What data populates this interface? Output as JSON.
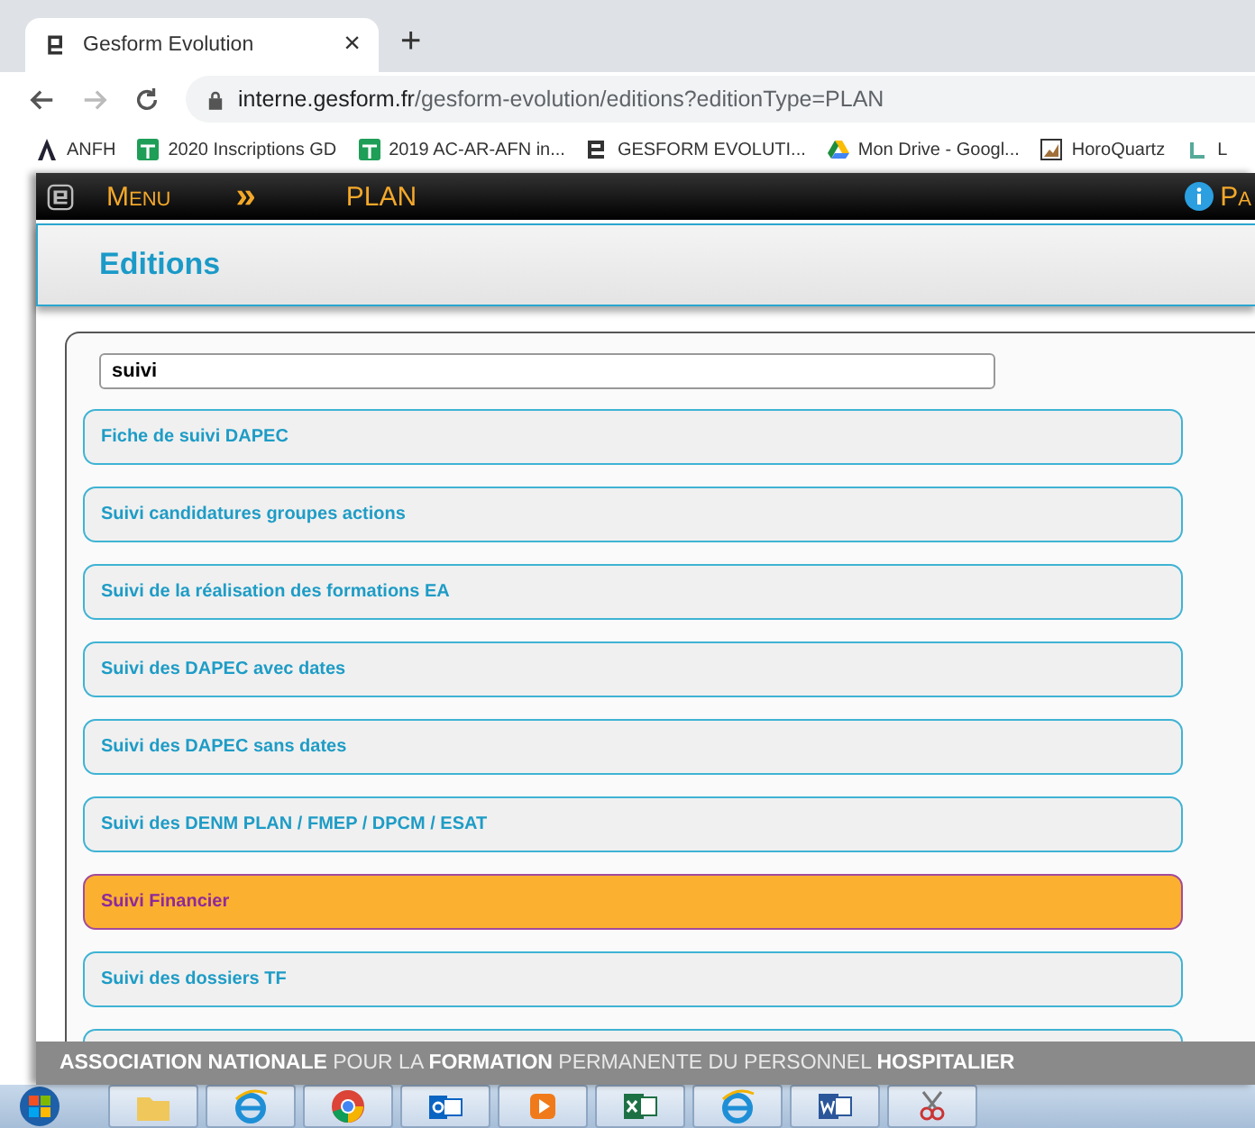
{
  "browser": {
    "tab": {
      "title": "Gesform Evolution",
      "close": "×"
    },
    "new_tab": "+",
    "nav": [
      {
        "kind": "back",
        "disabled": false
      },
      {
        "kind": "forward",
        "disabled": true
      },
      {
        "kind": "reload",
        "disabled": false
      }
    ],
    "url": {
      "host": "interne.gesform.fr",
      "path": "/gesform-evolution/editions?editionType=PLAN"
    },
    "bookmarks": [
      {
        "kind": "anfh",
        "label": "ANFH"
      },
      {
        "kind": "sheet",
        "label": "2020 Inscriptions GD"
      },
      {
        "kind": "sheet",
        "label": "2019 AC-AR-AFN in..."
      },
      {
        "kind": "gesform",
        "label": "GESFORM EVOLUTI..."
      },
      {
        "kind": "drive",
        "label": "Mon Drive - Googl..."
      },
      {
        "kind": "image",
        "label": "HoroQuartz"
      },
      {
        "kind": "swirl",
        "label": "L"
      }
    ]
  },
  "app_bar": {
    "menu": "Menu",
    "arrows": "»",
    "section": "PLAN",
    "right": "Pa"
  },
  "page_title": "Editions",
  "search": {
    "value": "suivi"
  },
  "items": [
    {
      "label": "Fiche de suivi DAPEC",
      "selected": false
    },
    {
      "label": "Suivi candidatures groupes actions",
      "selected": false
    },
    {
      "label": "Suivi de la réalisation des formations EA",
      "selected": false
    },
    {
      "label": "Suivi des DAPEC avec dates",
      "selected": false
    },
    {
      "label": "Suivi des DAPEC sans dates",
      "selected": false
    },
    {
      "label": "Suivi des DENM PLAN / FMEP / DPCM / ESAT",
      "selected": false
    },
    {
      "label": "Suivi Financier",
      "selected": true
    },
    {
      "label": "Suivi des dossiers TF",
      "selected": false
    }
  ],
  "footer": "**ASSOCIATION NATIONALE** POUR LA **FORMATION** PERMANENTE DU PERSONNEL **HOSPITALIER**",
  "taskbar": [
    {
      "kind": "folder"
    },
    {
      "kind": "ie"
    },
    {
      "kind": "chrome"
    },
    {
      "kind": "mail"
    },
    {
      "kind": "media"
    },
    {
      "kind": "sheet"
    },
    {
      "kind": "ie"
    },
    {
      "kind": "doc"
    },
    {
      "kind": "snip"
    }
  ]
}
